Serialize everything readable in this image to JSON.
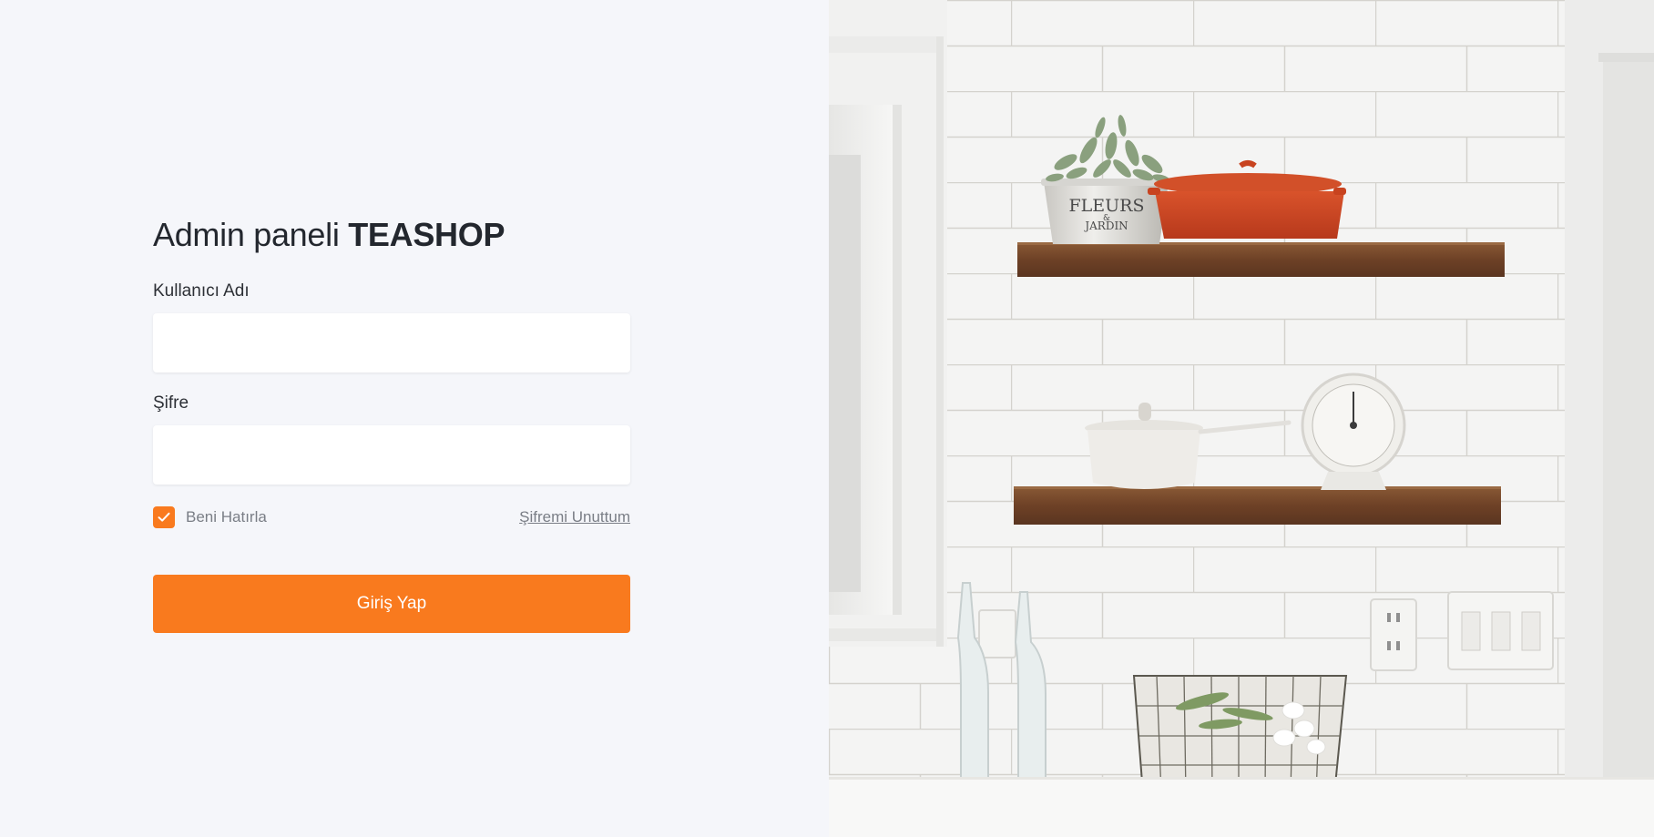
{
  "login": {
    "title_prefix": "Admin paneli ",
    "title_brand": "TEASHOP",
    "username_label": "Kullanıcı Adı",
    "username_value": "",
    "password_label": "Şifre",
    "password_value": "",
    "remember_label": "Beni Hatırla",
    "remember_checked": true,
    "forgot_label": "Şifremi Unuttum",
    "submit_label": "Giriş Yap"
  },
  "photo": {
    "pot_text_line1": "FLEURS",
    "pot_text_line2": "&",
    "pot_text_line3": "JARDIN"
  },
  "colors": {
    "accent": "#f97a1e",
    "background": "#f5f6fa",
    "title_text": "#23272e",
    "muted_text": "#7a7e86"
  }
}
